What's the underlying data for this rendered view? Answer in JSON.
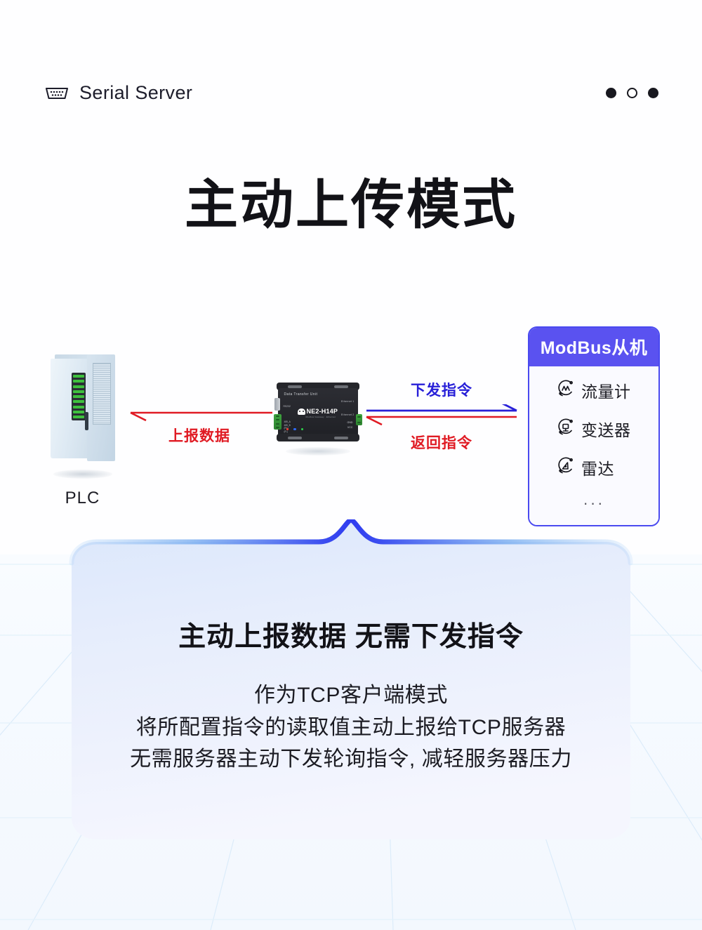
{
  "header": {
    "brand_title": "Serial Server",
    "brand_icon": "serial-port-icon",
    "dots": [
      {
        "name": "dot-filled-1",
        "style": "filled"
      },
      {
        "name": "dot-hollow",
        "style": "hollow"
      },
      {
        "name": "dot-filled-2",
        "style": "filled"
      }
    ]
  },
  "main_title": "主动上传模式",
  "diagram": {
    "plc": {
      "label": "PLC",
      "icon": "plc-cabinet-icon"
    },
    "dtu": {
      "icon": "data-transfer-unit-icon",
      "title": "Data Transfer Unit",
      "model": "NE2-H14P",
      "sub_brand": "Modbus Gateway  ·  Ethernet",
      "rs232": "RS232",
      "ethernet_1": "Ethernet 1",
      "ethernet_2": "Ethernet 2",
      "gnd": "GND",
      "vcc": "VCC",
      "ports": "485_A(T+)\n485_B(T-)\n(R+)\n(R-)",
      "led_labels": [
        "PWR",
        "DATA",
        "LINK"
      ]
    },
    "arrow_uplink": {
      "label": "上报数据",
      "color": "#e01b24",
      "direction": "left"
    },
    "arrow_downlink": {
      "label": "下发指令",
      "color": "#2820d8",
      "direction": "right"
    },
    "arrow_return": {
      "label": "返回指令",
      "color": "#e01b24",
      "direction": "left"
    },
    "modbus_panel": {
      "title": "ModBus从机",
      "header_color": "#5a52f0",
      "border_color": "#4a4af0",
      "items": [
        {
          "label": "流量计",
          "icon": "flow-meter-icon"
        },
        {
          "label": "变送器",
          "icon": "transmitter-icon"
        },
        {
          "label": "雷达",
          "icon": "radar-icon"
        }
      ],
      "ellipsis": "···"
    }
  },
  "bottom_card": {
    "heading": "主动上报数据  无需下发指令",
    "lines": [
      "作为TCP客户端模式",
      "将所配置指令的读取值主动上报给TCP服务器",
      "无需服务器主动下发轮询指令, 减轻服务器压力"
    ]
  }
}
